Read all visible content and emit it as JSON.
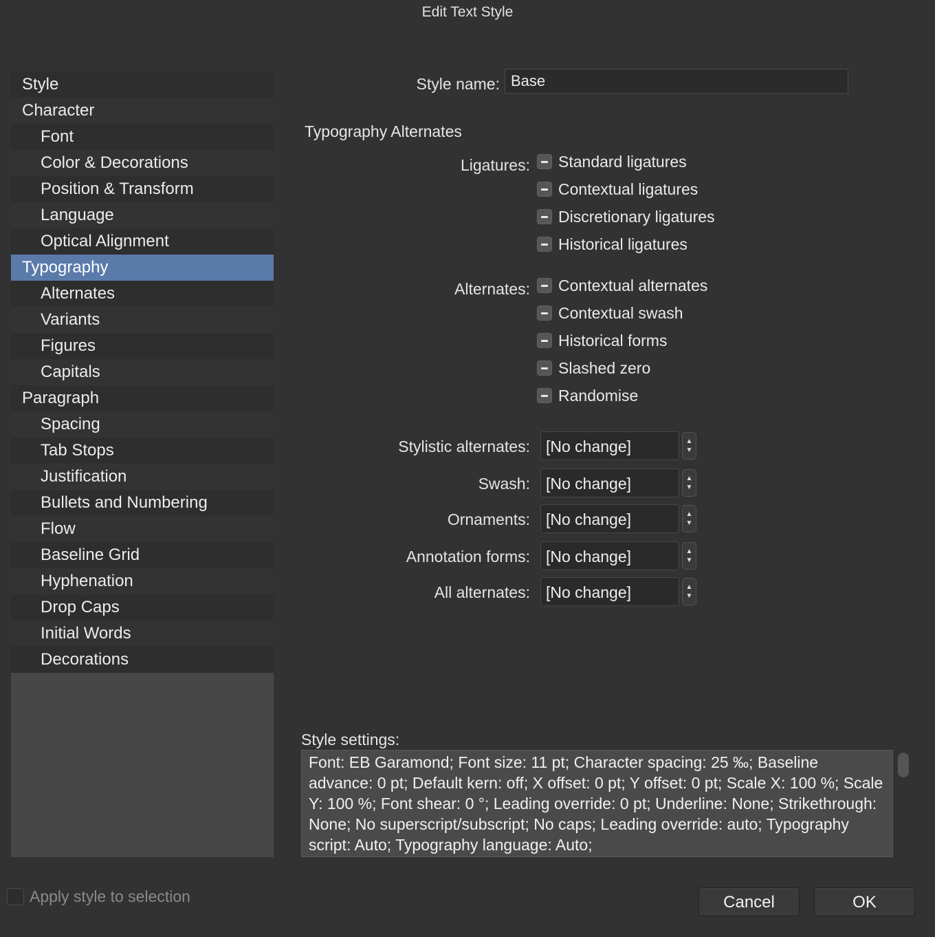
{
  "window": {
    "title": "Edit Text Style"
  },
  "sidebar": {
    "items": [
      {
        "label": "Style",
        "level": 0
      },
      {
        "label": "Character",
        "level": 0
      },
      {
        "label": "Font",
        "level": 1
      },
      {
        "label": "Color & Decorations",
        "level": 1
      },
      {
        "label": "Position & Transform",
        "level": 1
      },
      {
        "label": "Language",
        "level": 1
      },
      {
        "label": "Optical Alignment",
        "level": 1
      },
      {
        "label": "Typography",
        "level": 0,
        "selected": true
      },
      {
        "label": "Alternates",
        "level": 1
      },
      {
        "label": "Variants",
        "level": 1
      },
      {
        "label": "Figures",
        "level": 1
      },
      {
        "label": "Capitals",
        "level": 1
      },
      {
        "label": "Paragraph",
        "level": 0
      },
      {
        "label": "Spacing",
        "level": 1
      },
      {
        "label": "Tab Stops",
        "level": 1
      },
      {
        "label": "Justification",
        "level": 1
      },
      {
        "label": "Bullets and Numbering",
        "level": 1
      },
      {
        "label": "Flow",
        "level": 1
      },
      {
        "label": "Baseline Grid",
        "level": 1
      },
      {
        "label": "Hyphenation",
        "level": 1
      },
      {
        "label": "Drop Caps",
        "level": 1
      },
      {
        "label": "Initial Words",
        "level": 1
      },
      {
        "label": "Decorations",
        "level": 1
      }
    ]
  },
  "style_name": {
    "label": "Style name:",
    "value": "Base"
  },
  "section_title": "Typography Alternates",
  "ligatures": {
    "label": "Ligatures:",
    "options": [
      {
        "label": "Standard ligatures",
        "state": "mixed"
      },
      {
        "label": "Contextual ligatures",
        "state": "mixed"
      },
      {
        "label": "Discretionary ligatures",
        "state": "mixed"
      },
      {
        "label": "Historical ligatures",
        "state": "mixed"
      }
    ]
  },
  "alternates": {
    "label": "Alternates:",
    "options": [
      {
        "label": "Contextual alternates",
        "state": "mixed"
      },
      {
        "label": "Contextual swash",
        "state": "mixed"
      },
      {
        "label": "Historical forms",
        "state": "mixed"
      },
      {
        "label": "Slashed zero",
        "state": "mixed"
      },
      {
        "label": "Randomise",
        "state": "mixed"
      }
    ]
  },
  "selects": [
    {
      "label": "Stylistic alternates:",
      "value": "[No change]"
    },
    {
      "label": "Swash:",
      "value": "[No change]"
    },
    {
      "label": "Ornaments:",
      "value": "[No change]"
    },
    {
      "label": "Annotation forms:",
      "value": "[No change]"
    },
    {
      "label": "All alternates:",
      "value": "[No change]"
    }
  ],
  "style_settings": {
    "label": "Style settings:",
    "text": "Font: EB Garamond; Font size: 11 pt; Character spacing: 25 ‰; Baseline advance: 0 pt; Default kern: off; X offset: 0 pt; Y offset: 0 pt; Scale X: 100 %; Scale Y: 100 %; Font shear: 0 °; Leading override: 0 pt; Underline: None; Strikethrough: None; No superscript/subscript; No caps; Leading override: auto; Typography script: Auto; Typography language: Auto;"
  },
  "footer": {
    "apply_label": "Apply style to selection",
    "cancel_label": "Cancel",
    "ok_label": "OK"
  },
  "colors": {
    "background": "#323232",
    "selected": "#5a7baa"
  }
}
